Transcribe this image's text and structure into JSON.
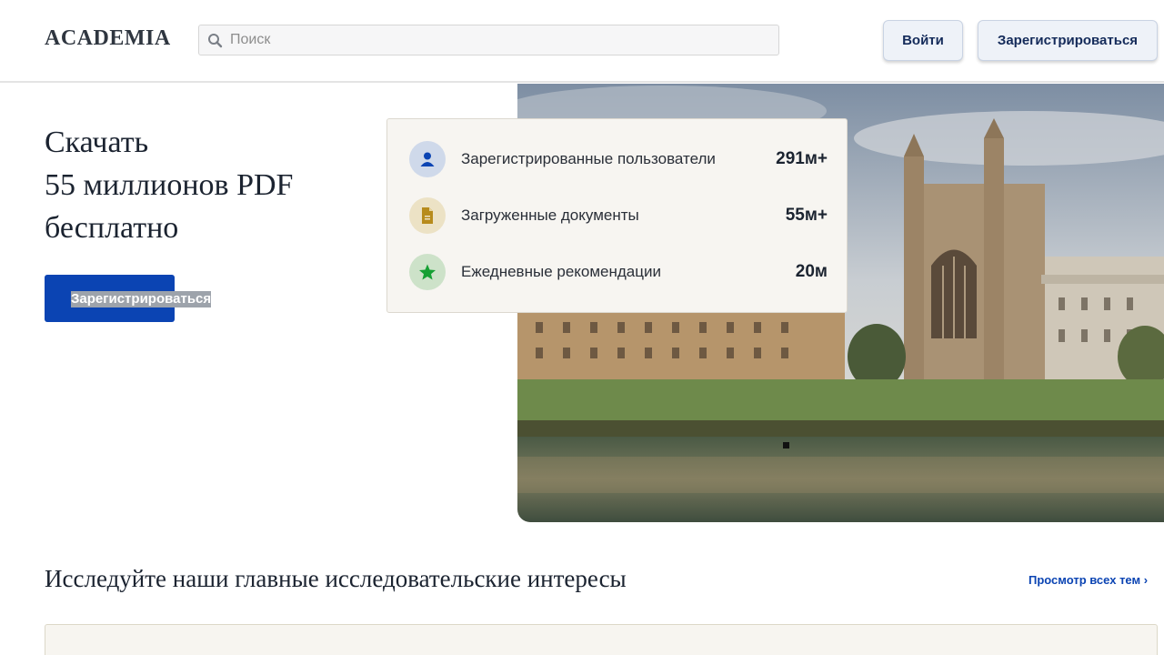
{
  "header": {
    "logo": "ACADEMIA",
    "search_placeholder": "Поиск",
    "login_label": "Войти",
    "signup_label": "Зарегистрироваться"
  },
  "hero": {
    "title_lines": [
      "Скачать",
      "55 миллионов PDF",
      "бесплатно"
    ],
    "cta_label": "Зарегистрироваться"
  },
  "stats": [
    {
      "label": "Зарегистрированные пользователи",
      "value": "291м+",
      "icon": "user-icon",
      "color": "#0b44b3",
      "bg": "#cfd9ea"
    },
    {
      "label": "Загруженные документы",
      "value": "55м+",
      "icon": "document-icon",
      "color": "#b78b1c",
      "bg": "#ece2c5"
    },
    {
      "label": "Ежедневные рекомендации",
      "value": "20м",
      "icon": "star-icon",
      "color": "#16a034",
      "bg": "#cde2c9"
    }
  ],
  "section": {
    "title": "Исследуйте наши главные исследовательские интересы",
    "view_all_label": "Просмотр всех тем ›"
  },
  "colors": {
    "brand_blue": "#0b44b3",
    "card_bg": "#f7f5f1"
  }
}
